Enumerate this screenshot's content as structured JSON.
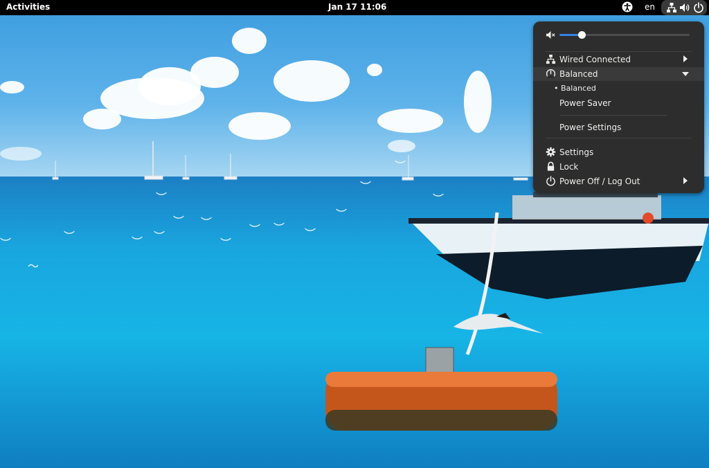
{
  "topbar": {
    "activities": "Activities",
    "clock": "Jan 17  11:06",
    "language": "en",
    "icons": [
      "accessibility-icon",
      "network-wired-icon",
      "volume-icon",
      "power-icon"
    ]
  },
  "quick_menu": {
    "volume": {
      "icon": "volume-muted-icon",
      "level": 0.17
    },
    "network": {
      "label": "Wired Connected",
      "icon": "network-wired-icon"
    },
    "power_profile": {
      "label": "Balanced",
      "icon": "power-profile-icon",
      "options": [
        "• Balanced",
        "Power Saver"
      ],
      "settings_label": "Power Settings"
    },
    "settings": "Settings",
    "lock": "Lock",
    "power_off": "Power Off / Log Out"
  },
  "colors": {
    "topbar": "#000000",
    "menu_bg": "#2d2d2d",
    "accent": "#3584e4",
    "text": "#eeeeec"
  }
}
